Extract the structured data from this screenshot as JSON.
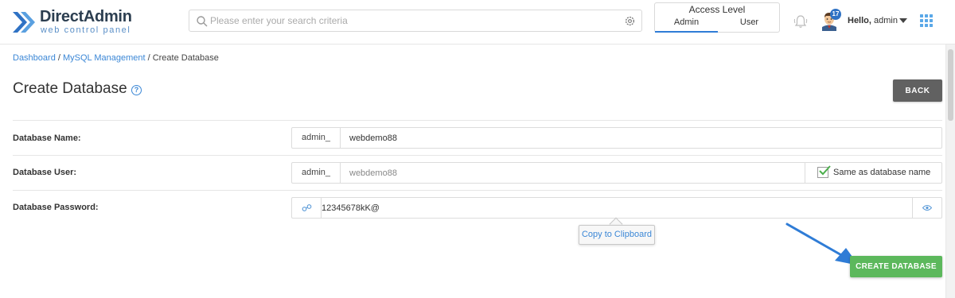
{
  "header": {
    "brand_title": "DirectAdmin",
    "brand_subtitle": "web control panel",
    "search_placeholder": "Please enter your search criteria",
    "access_level": {
      "title": "Access Level",
      "options": [
        "Admin",
        "User"
      ],
      "selected": "Admin"
    },
    "notifications_count": "17",
    "greeting": "Hello,",
    "username": "admin"
  },
  "breadcrumb": {
    "items": [
      "Dashboard",
      "MySQL Management"
    ],
    "current": "Create Database",
    "separator": " / "
  },
  "page": {
    "title": "Create Database",
    "back_label": "BACK"
  },
  "form": {
    "db_name": {
      "label": "Database Name:",
      "prefix": "admin_",
      "value": "webdemo88"
    },
    "db_user": {
      "label": "Database User:",
      "prefix": "admin_",
      "value": "webdemo88",
      "same_as_label": "Same as database name",
      "same_as_checked": true
    },
    "db_password": {
      "label": "Database Password:",
      "value": "12345678kK@"
    },
    "tooltip": "Copy to Clipboard",
    "submit_label": "CREATE DATABASE"
  },
  "colors": {
    "accent": "#3b87d6",
    "back_button": "#616161",
    "create_button": "#5cb85c",
    "annotation_arrow": "#2f7cd6"
  },
  "icons": {
    "logo": "directadmin-logo-icon",
    "search": "search-icon",
    "search_settings": "gear-icon",
    "notifications": "bell-icon",
    "avatar": "avatar-icon",
    "user_menu": "chevron-down-icon",
    "apps": "grid-icon",
    "help": "question-circle-icon",
    "password_generate": "key-icon",
    "password_toggle": "eye-icon",
    "annotation": "arrow-icon"
  }
}
